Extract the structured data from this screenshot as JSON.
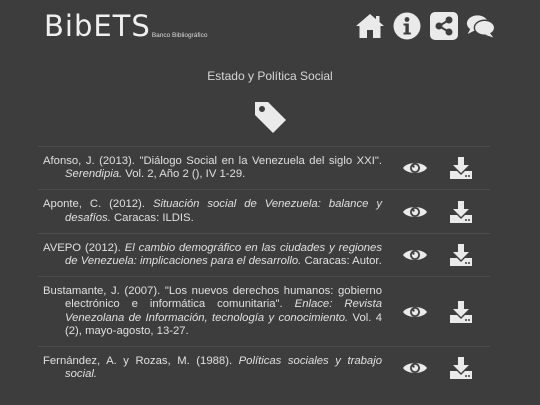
{
  "brand": {
    "name": "BibETS",
    "tagline": "Banco Bibliográfico"
  },
  "nav": [
    {
      "icon": "home-icon"
    },
    {
      "icon": "info-icon"
    },
    {
      "icon": "share-icon"
    },
    {
      "icon": "comments-icon"
    }
  ],
  "page": {
    "subtitle": "Estado y Política Social",
    "section_icon": "tag-icon"
  },
  "colors": {
    "background": "#3d3d3d",
    "text": "#e0e0e0",
    "icon": "#eaeaea"
  },
  "references": [
    {
      "parts": [
        {
          "t": "Afonso, J. (2013). \"Diálogo Social en la Venezuela del siglo XXI\". "
        },
        {
          "t": "Serendipia.",
          "i": true
        },
        {
          "t": " Vol. 2, Año 2 (), IV 1-29."
        }
      ]
    },
    {
      "parts": [
        {
          "t": "Aponte, C. (2012). "
        },
        {
          "t": "Situación social de Venezuela: balance y desafíos.",
          "i": true
        },
        {
          "t": " Caracas: ILDIS."
        }
      ]
    },
    {
      "parts": [
        {
          "t": "AVEPO (2012). "
        },
        {
          "t": "El cambio demográfico en las ciudades y regiones de Venezuela: implicaciones para el desarrollo.",
          "i": true
        },
        {
          "t": " Caracas: Autor."
        }
      ]
    },
    {
      "parts": [
        {
          "t": "Bustamante, J. (2007). \"Los nuevos derechos humanos: gobierno electrónico e informática comunitaria\". "
        },
        {
          "t": "Enlace: Revista Venezolana de Información, tecnología y conocimiento.",
          "i": true
        },
        {
          "t": " Vol. 4 (2), mayo-agosto, 13-27."
        }
      ]
    },
    {
      "parts": [
        {
          "t": "Fernández, A. y Rozas, M. (1988). "
        },
        {
          "t": "Políticas sociales y trabajo social.",
          "i": true
        },
        {
          "t": ""
        }
      ]
    }
  ]
}
